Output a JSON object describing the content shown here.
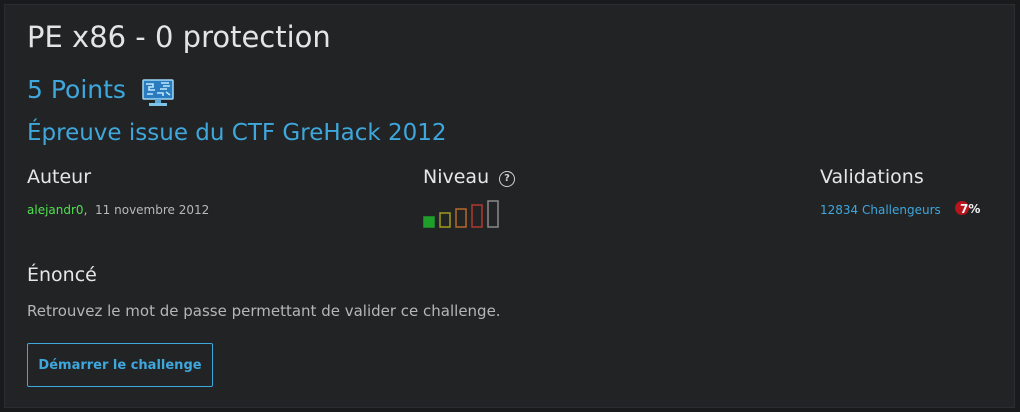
{
  "challenge": {
    "title": "PE x86 - 0 protection",
    "points": "5 Points",
    "source": "Épreuve issue du CTF GreHack 2012"
  },
  "author": {
    "heading": "Auteur",
    "name": "alejandr0",
    "separator": ",",
    "date": "11 novembre 2012"
  },
  "level": {
    "heading": "Niveau",
    "help_glyph": "?",
    "current_level": 1,
    "max_level": 5,
    "colors": [
      "#1e9f2c",
      "#a39a1c",
      "#b8692a",
      "#b0392c",
      "#8a8a8a"
    ]
  },
  "validations": {
    "heading": "Validations",
    "count_label": "12834 Challengeurs",
    "percent": "7%",
    "badge_color": "#b8141c"
  },
  "statement": {
    "heading": "Énoncé",
    "text": "Retrouvez le mot de passe permettant de valider ce challenge."
  },
  "actions": {
    "start_label": "Démarrer le challenge"
  },
  "colors": {
    "accent": "#3ea7dc",
    "author": "#4ee04e",
    "background": "#222325"
  }
}
